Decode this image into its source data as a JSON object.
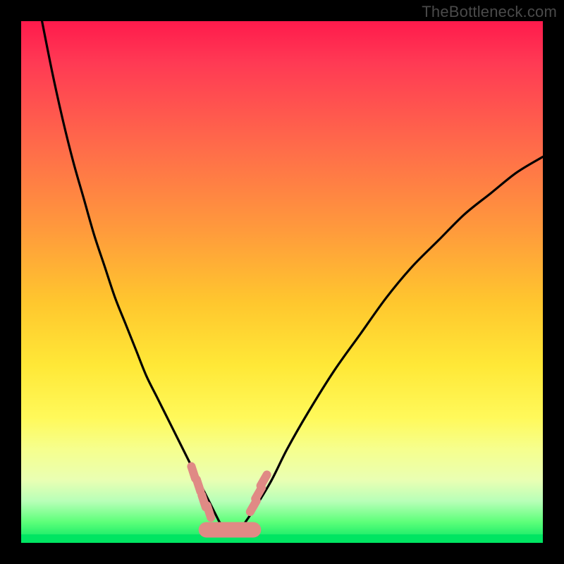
{
  "watermark": "TheBottleneck.com",
  "colors": {
    "frame": "#000000",
    "gradient_top": "#ff1a4c",
    "gradient_mid1": "#ff9a3c",
    "gradient_mid2": "#ffe837",
    "gradient_bottom": "#00e562",
    "curve_stroke": "#000000",
    "marker_fill": "#e08a85",
    "marker_stroke_soft": "#b86b66"
  },
  "chart_data": {
    "type": "line",
    "title": "",
    "xlabel": "",
    "ylabel": "",
    "xlim": [
      0,
      100
    ],
    "ylim": [
      0,
      100
    ],
    "grid": false,
    "legend": false,
    "series": [
      {
        "name": "left-branch",
        "x": [
          4,
          6,
          8,
          10,
          12,
          14,
          16,
          18,
          20,
          22,
          24,
          26,
          28,
          30,
          32,
          33.5,
          35,
          36.5,
          38
        ],
        "y": [
          100,
          90,
          81,
          73,
          66,
          59,
          53,
          47,
          42,
          37,
          32,
          28,
          24,
          20,
          16,
          13,
          10,
          7,
          4
        ]
      },
      {
        "name": "right-branch",
        "x": [
          43,
          45,
          48,
          51,
          55,
          60,
          65,
          70,
          75,
          80,
          85,
          90,
          95,
          100
        ],
        "y": [
          4,
          7,
          12,
          18,
          25,
          33,
          40,
          47,
          53,
          58,
          63,
          67,
          71,
          74
        ]
      },
      {
        "name": "valley-floor",
        "x": [
          38,
          39.5,
          41,
          42,
          43
        ],
        "y": [
          4,
          2.5,
          2,
          2.5,
          4
        ]
      }
    ],
    "annotations": {
      "markers_left_branch": {
        "description": "short soft-red capsule markers on left valley wall near bottom",
        "points": [
          {
            "x": 33.0,
            "y": 13.5
          },
          {
            "x": 34.0,
            "y": 11.0
          },
          {
            "x": 35.0,
            "y": 8.0
          },
          {
            "x": 36.0,
            "y": 6.0
          }
        ]
      },
      "markers_right_branch": {
        "description": "short soft-red capsule markers on right valley wall near bottom",
        "points": [
          {
            "x": 44.5,
            "y": 7.0
          },
          {
            "x": 45.5,
            "y": 9.5
          },
          {
            "x": 46.5,
            "y": 12.0
          }
        ]
      },
      "valley_fill": {
        "description": "thick soft-red rounded stroke sitting at the valley floor between branches",
        "x_range": [
          35.5,
          44.5
        ],
        "y": 2.5
      }
    }
  }
}
